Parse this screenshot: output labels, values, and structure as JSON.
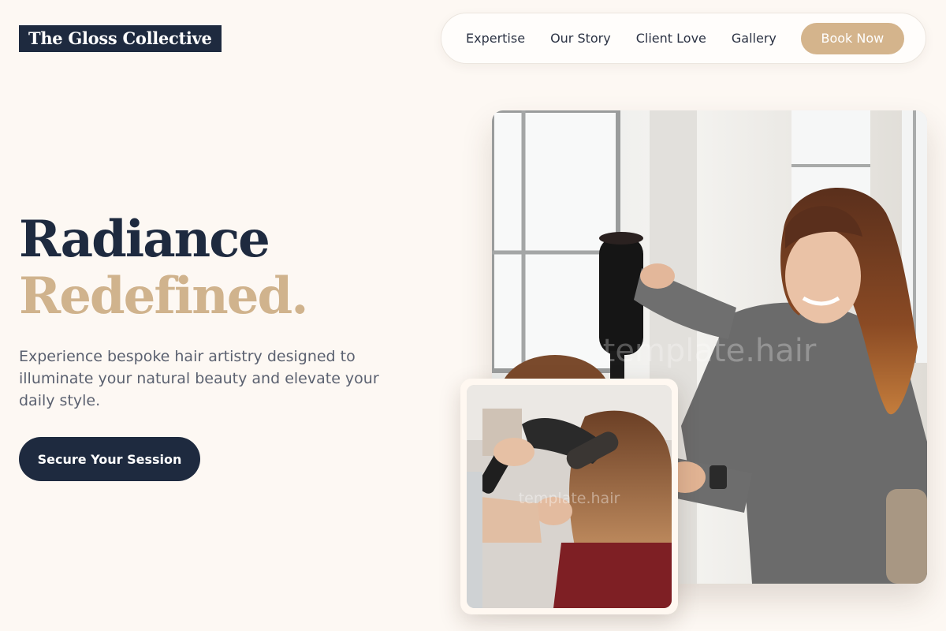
{
  "brand": {
    "name": "The Gloss Collective"
  },
  "nav": {
    "links": [
      "Expertise",
      "Our Story",
      "Client Love",
      "Gallery"
    ],
    "cta_label": "Book Now"
  },
  "hero": {
    "title_line1": "Radiance",
    "title_line2": "Redefined.",
    "subtitle": "Experience bespoke hair artistry designed to illuminate your natural beauty and elevate your daily style.",
    "cta_label": "Secure Your Session"
  },
  "images": {
    "main_watermark": "template.hair",
    "small_watermark": "template.hair"
  },
  "colors": {
    "background": "#fdf8f3",
    "navy": "#1e2a3f",
    "gold": "#d4b48c"
  }
}
